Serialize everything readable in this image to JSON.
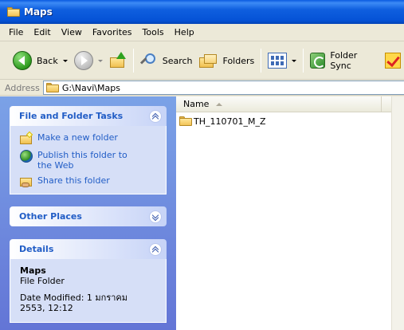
{
  "window": {
    "title": "Maps"
  },
  "menu": [
    "File",
    "Edit",
    "View",
    "Favorites",
    "Tools",
    "Help"
  ],
  "toolbar": {
    "back_label": "Back",
    "search_label": "Search",
    "folders_label": "Folders",
    "folder_sync_label": "Folder Sync"
  },
  "address": {
    "label": "Address",
    "value": "G:\\Navi\\Maps"
  },
  "tasks_panel": {
    "title": "File and Folder Tasks",
    "items": [
      {
        "label": "Make a new folder",
        "icon": "new-folder-icon"
      },
      {
        "label": "Publish this folder to the Web",
        "icon": "globe-icon"
      },
      {
        "label": "Share this folder",
        "icon": "share-folder-icon"
      }
    ]
  },
  "other_places": {
    "title": "Other Places"
  },
  "details": {
    "title": "Details",
    "name": "Maps",
    "type": "File Folder",
    "date_modified": "Date Modified: 1 มกราคม 2553, 12:12"
  },
  "file_list": {
    "column_name": "Name",
    "items": [
      {
        "name": "TH_110701_M_Z",
        "icon": "folder-icon"
      }
    ]
  },
  "colors": {
    "title_bar": "#0552d6",
    "link_blue": "#215dc6",
    "panel_bg": "#d6dff7"
  }
}
